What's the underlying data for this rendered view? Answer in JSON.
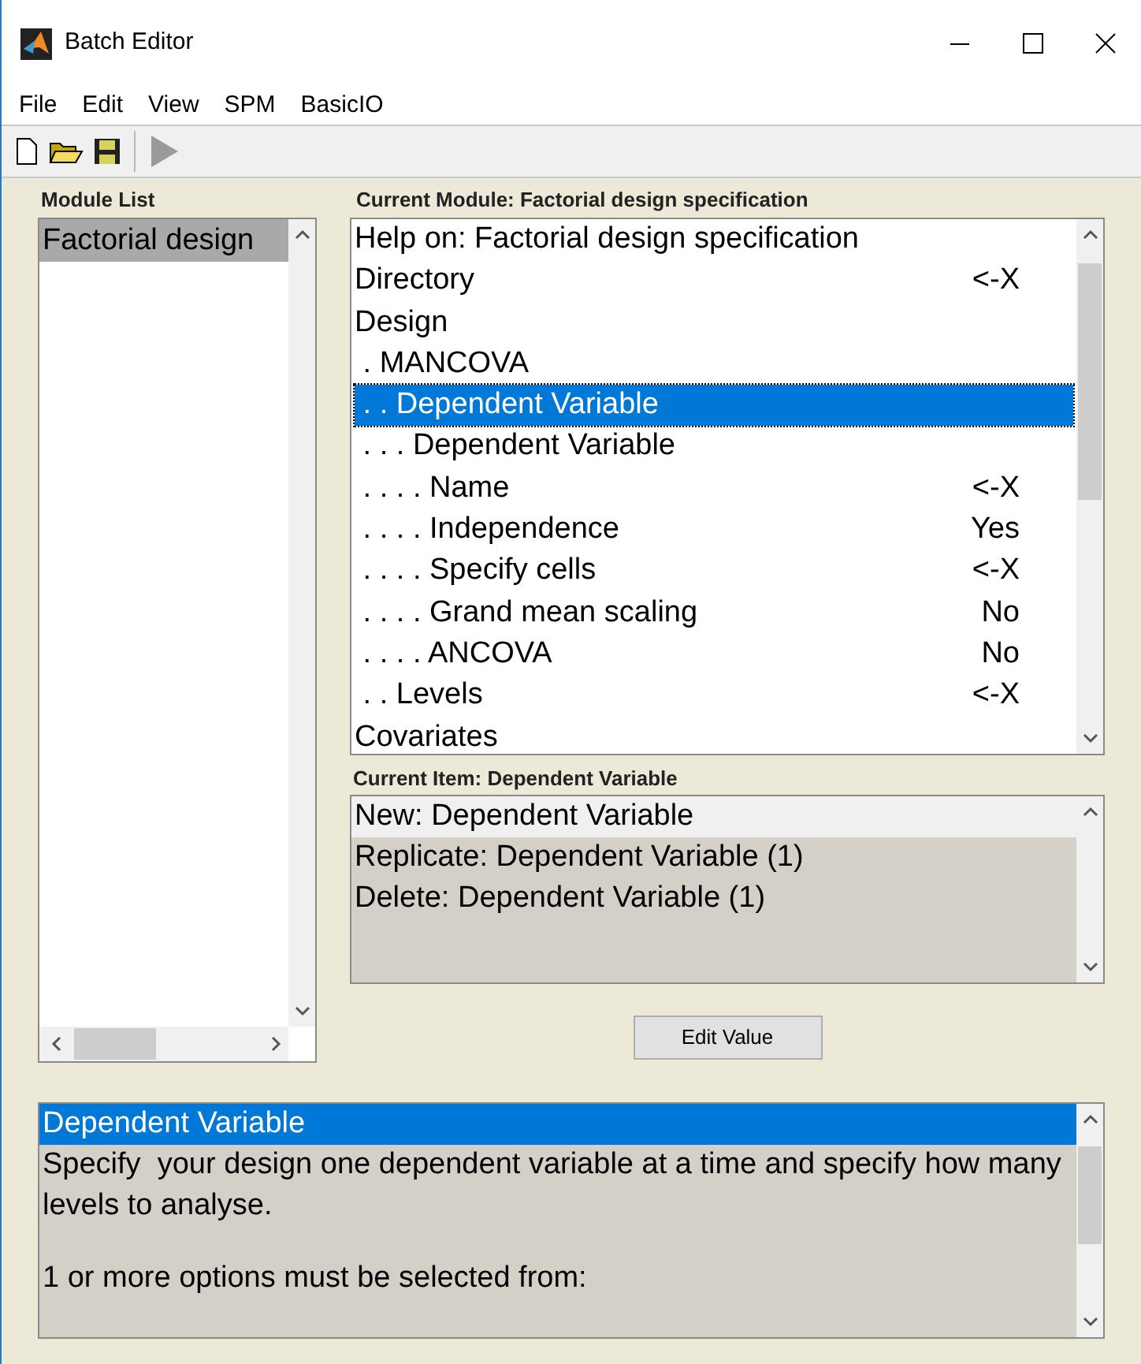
{
  "window": {
    "title": "Batch Editor"
  },
  "menu": [
    "File",
    "Edit",
    "View",
    "SPM",
    "BasicIO"
  ],
  "module_list": {
    "label": "Module List",
    "items": [
      {
        "label": "Factorial design",
        "selected": true
      }
    ]
  },
  "current_module": {
    "label": "Current Module: Factorial design specification",
    "rows": [
      {
        "label": "Help on: Factorial design specification",
        "value": "",
        "selected": false
      },
      {
        "label": "Directory",
        "value": "<-X",
        "selected": false
      },
      {
        "label": "Design",
        "value": "",
        "selected": false
      },
      {
        "label": " . MANCOVA",
        "value": "",
        "selected": false
      },
      {
        "label": " . . Dependent Variable",
        "value": "",
        "selected": true
      },
      {
        "label": " . . . Dependent Variable",
        "value": "",
        "selected": false
      },
      {
        "label": " . . . . Name",
        "value": "<-X",
        "selected": false
      },
      {
        "label": " . . . . Independence",
        "value": "Yes",
        "selected": false
      },
      {
        "label": " . . . . Specify cells",
        "value": "<-X",
        "selected": false
      },
      {
        "label": " . . . . Grand mean scaling",
        "value": "No",
        "selected": false
      },
      {
        "label": " . . . . ANCOVA",
        "value": "No",
        "selected": false
      },
      {
        "label": " . . Levels",
        "value": "<-X",
        "selected": false
      },
      {
        "label": "Covariates",
        "value": "",
        "selected": false
      }
    ]
  },
  "current_item": {
    "label": "Current Item: Dependent Variable",
    "options": [
      {
        "label": "New: Dependent Variable",
        "selected": true
      },
      {
        "label": "Replicate: Dependent Variable (1)",
        "selected": false
      },
      {
        "label": "Delete: Dependent Variable (1)",
        "selected": false
      }
    ]
  },
  "edit_button": "Edit Value",
  "help": {
    "title": "Dependent Variable",
    "lines": [
      "Specify  your design one dependent variable at a time and specify how many levels to analyse.",
      "1 or more options must be selected from:"
    ]
  }
}
